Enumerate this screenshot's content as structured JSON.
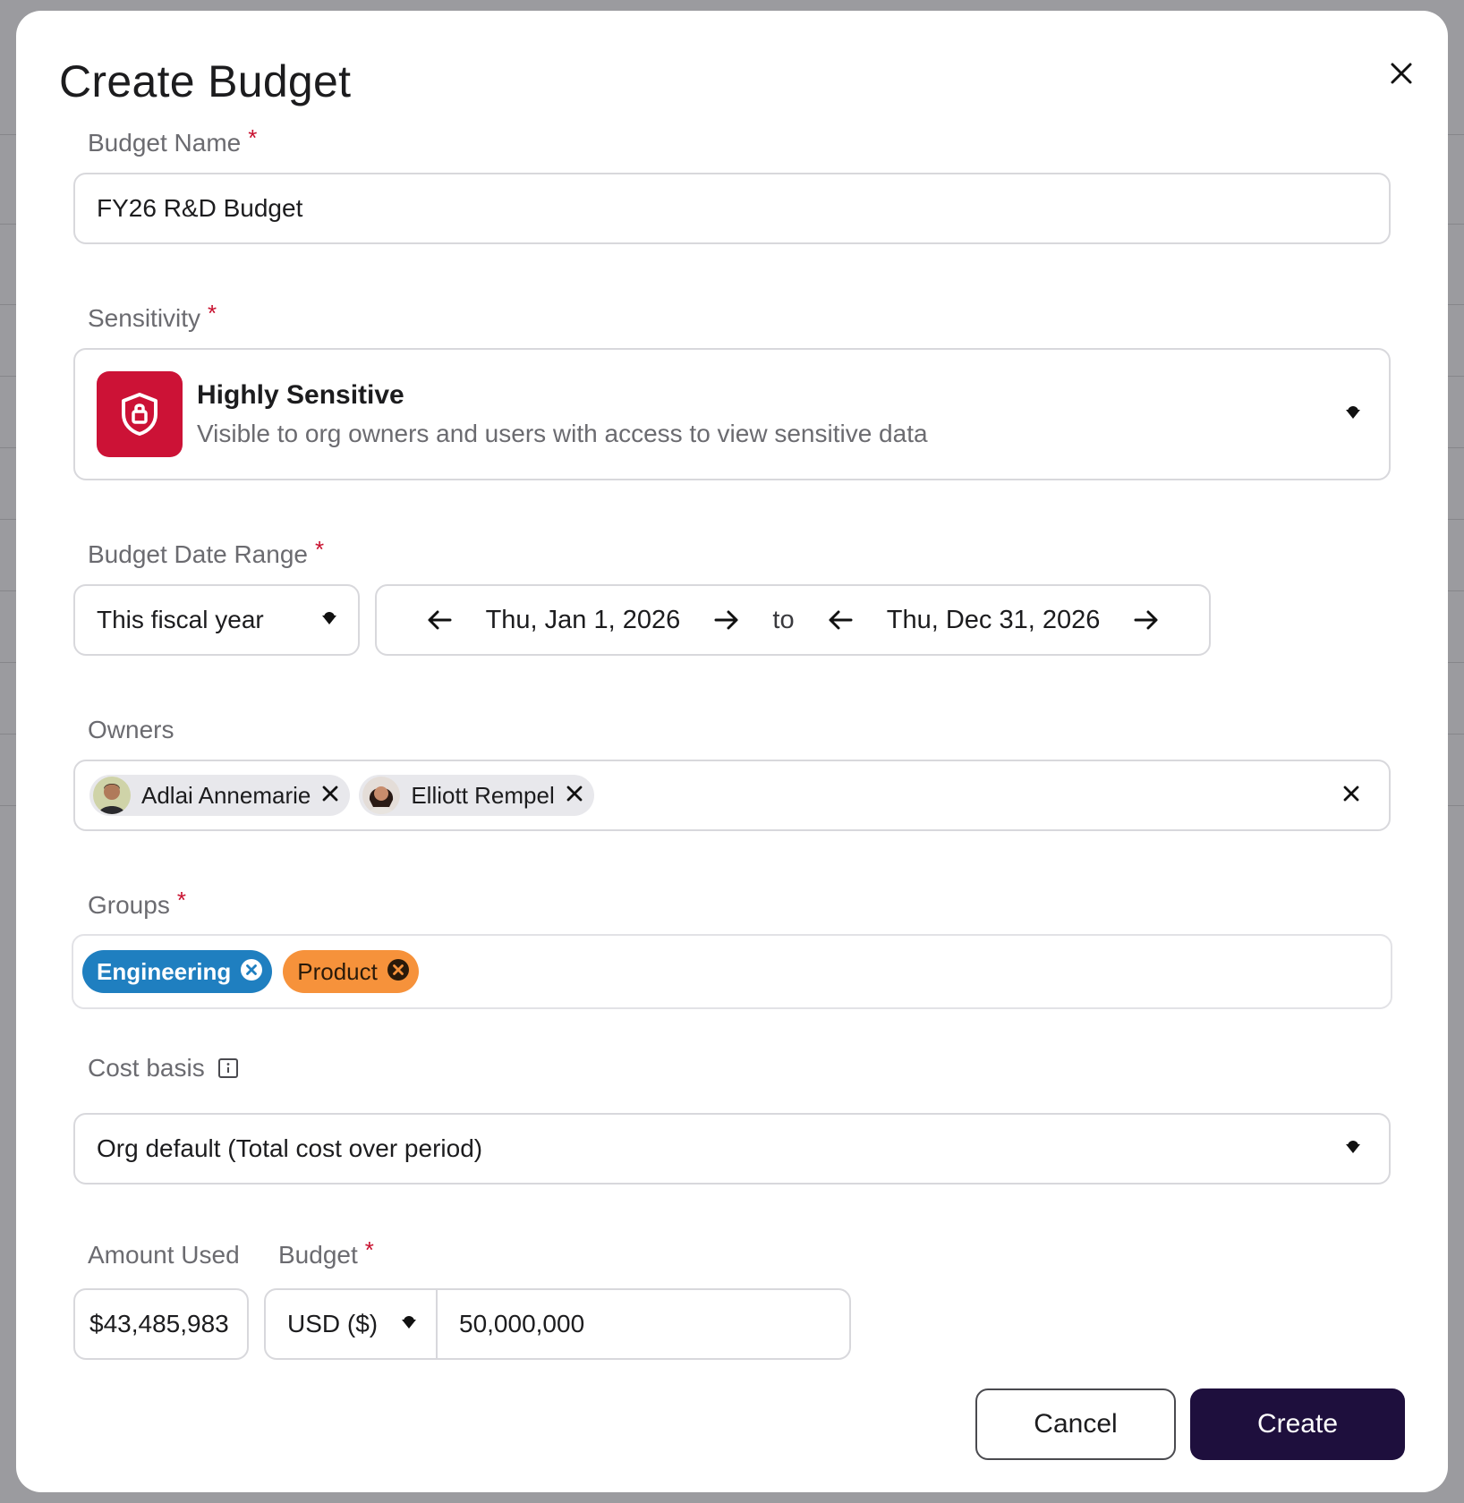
{
  "modal": {
    "title": "Create Budget"
  },
  "budget_name": {
    "label": "Budget Name",
    "value": "FY26 R&D Budget"
  },
  "sensitivity": {
    "label": "Sensitivity",
    "title": "Highly Sensitive",
    "description": "Visible to org owners and users with access to view sensitive data",
    "badge_color": "#cc1236"
  },
  "date_range": {
    "label": "Budget Date Range",
    "preset": "This fiscal year",
    "start": "Thu, Jan 1, 2026",
    "separator": "to",
    "end": "Thu, Dec 31, 2026"
  },
  "owners": {
    "label": "Owners",
    "items": [
      {
        "name": "Adlai Annemarie"
      },
      {
        "name": "Elliott Rempel"
      }
    ]
  },
  "groups": {
    "label": "Groups",
    "items": [
      {
        "name": "Engineering",
        "color": "#1f7fc0"
      },
      {
        "name": "Product",
        "color": "#f6923b"
      }
    ]
  },
  "cost_basis": {
    "label": "Cost basis",
    "value": "Org default (Total cost over period)"
  },
  "amount_used": {
    "label": "Amount Used",
    "value": "$43,485,983"
  },
  "budget": {
    "label": "Budget",
    "currency": "USD ($)",
    "value": "50,000,000"
  },
  "actions": {
    "cancel": "Cancel",
    "create": "Create"
  },
  "required_marker": "*"
}
